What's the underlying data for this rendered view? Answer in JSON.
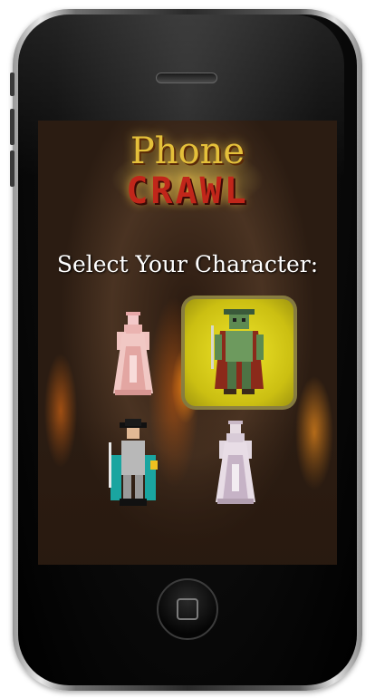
{
  "logo": {
    "line1": "Phone",
    "line2": "CRAWL"
  },
  "heading": "Select Your Character:",
  "characters": [
    {
      "icon": "pink-ghost-lady-character",
      "selected": false
    },
    {
      "icon": "green-armored-knight-character",
      "selected": true
    },
    {
      "icon": "black-hat-swordsman-character",
      "selected": false
    },
    {
      "icon": "white-ghost-lady-character",
      "selected": false
    }
  ],
  "colors": {
    "selection_highlight": "#e6dc20",
    "logo_gold": "#e4c03a",
    "logo_red": "#c1261a"
  }
}
